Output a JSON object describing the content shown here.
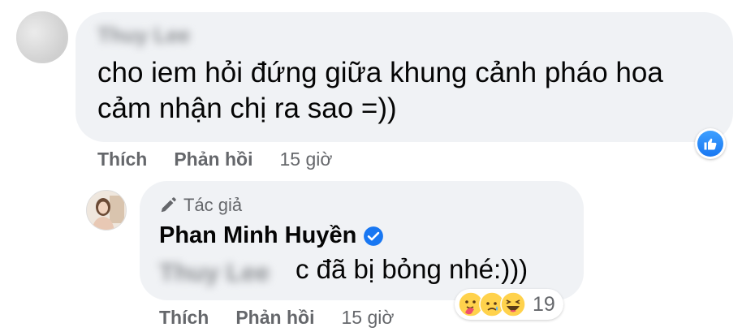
{
  "main_comment": {
    "author": "Thuy Lee",
    "text": "cho iem hỏi đứng giữa khung cảnh pháo hoa cảm nhận chị ra sao =))",
    "actions": {
      "like": "Thích",
      "reply": "Phản hồi",
      "time": "15 giờ"
    }
  },
  "reply": {
    "author_tag": "Tác giả",
    "author": "Phan Minh Huyền",
    "mention": "Thuy Lee",
    "text": "c đã bị bỏng nhé:)))",
    "actions": {
      "like": "Thích",
      "reply": "Phản hồi",
      "time": "15 giờ"
    },
    "reaction_count": "19",
    "reaction_icons": [
      "care-emoji-icon",
      "sad-emoji-icon",
      "haha-emoji-icon"
    ]
  },
  "colors": {
    "like_blue": "#1877f2",
    "bubble_gray": "#f0f2f5",
    "muted_text": "#65676b"
  }
}
